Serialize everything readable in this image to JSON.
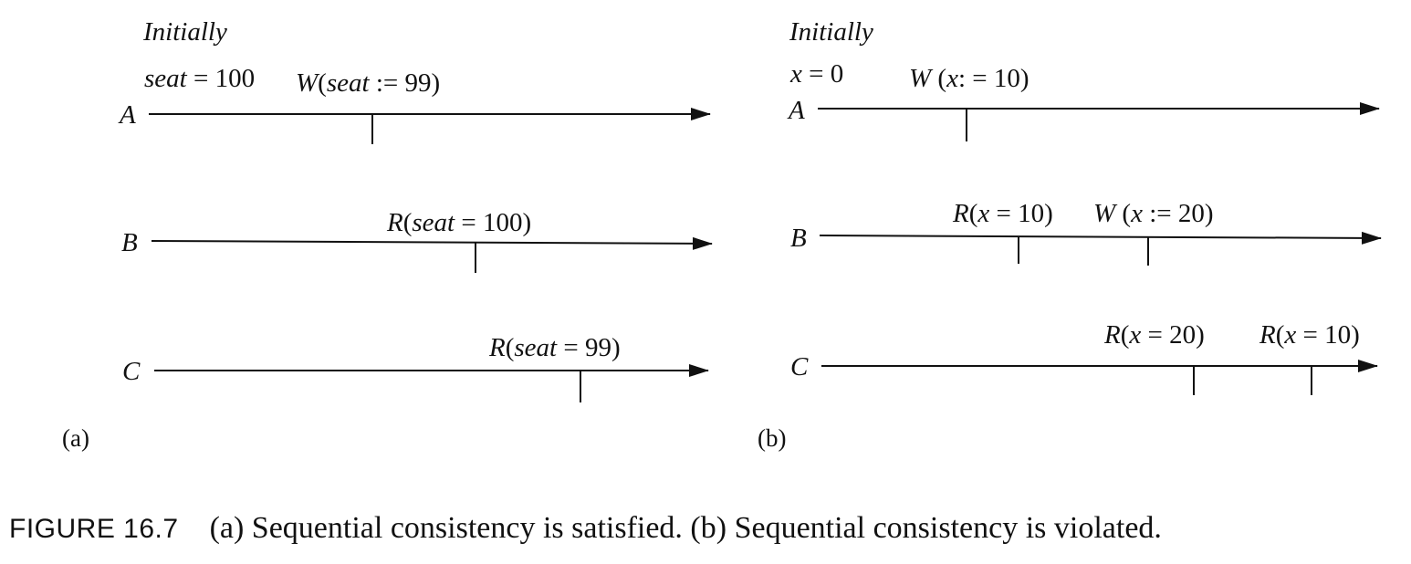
{
  "panels": [
    {
      "id": "a",
      "tag": "(a)",
      "initially_label": "Initially",
      "initial_state": {
        "var": "seat",
        "op": " = ",
        "val": "100"
      },
      "processes": [
        {
          "name": "A",
          "ops": [
            {
              "kind": "W",
              "pre": "(",
              "var": "seat",
              "rel": " := ",
              "val": "99",
              "post": ")"
            }
          ]
        },
        {
          "name": "B",
          "ops": [
            {
              "kind": "R",
              "pre": "(",
              "var": "seat",
              "rel": " = ",
              "val": "100",
              "post": ")"
            }
          ]
        },
        {
          "name": "C",
          "ops": [
            {
              "kind": "R",
              "pre": "(",
              "var": "seat",
              "rel": " = ",
              "val": "99",
              "post": ")"
            }
          ]
        }
      ]
    },
    {
      "id": "b",
      "tag": "(b)",
      "initially_label": "Initially",
      "initial_state": {
        "var": "x",
        "op": " = ",
        "val": "0"
      },
      "processes": [
        {
          "name": "A",
          "ops": [
            {
              "kind": "W",
              "pre": " (",
              "var": "x",
              "rel": ": = ",
              "val": "10",
              "post": ")"
            }
          ]
        },
        {
          "name": "B",
          "ops": [
            {
              "kind": "R",
              "pre": "(",
              "var": "x",
              "rel": " = ",
              "val": "10",
              "post": ")"
            },
            {
              "kind": "W",
              "pre": " (",
              "var": "x",
              "rel": " := ",
              "val": "20",
              "post": ")"
            }
          ]
        },
        {
          "name": "C",
          "ops": [
            {
              "kind": "R",
              "pre": "(",
              "var": "x",
              "rel": " = ",
              "val": "20",
              "post": ")"
            },
            {
              "kind": "R",
              "pre": "(",
              "var": "x",
              "rel": " = ",
              "val": "10",
              "post": ")"
            }
          ]
        }
      ]
    }
  ],
  "caption": {
    "figure_label": "FIGURE 16.7",
    "text": "(a) Sequential consistency is satisfied. (b) Sequential consistency is violated."
  }
}
